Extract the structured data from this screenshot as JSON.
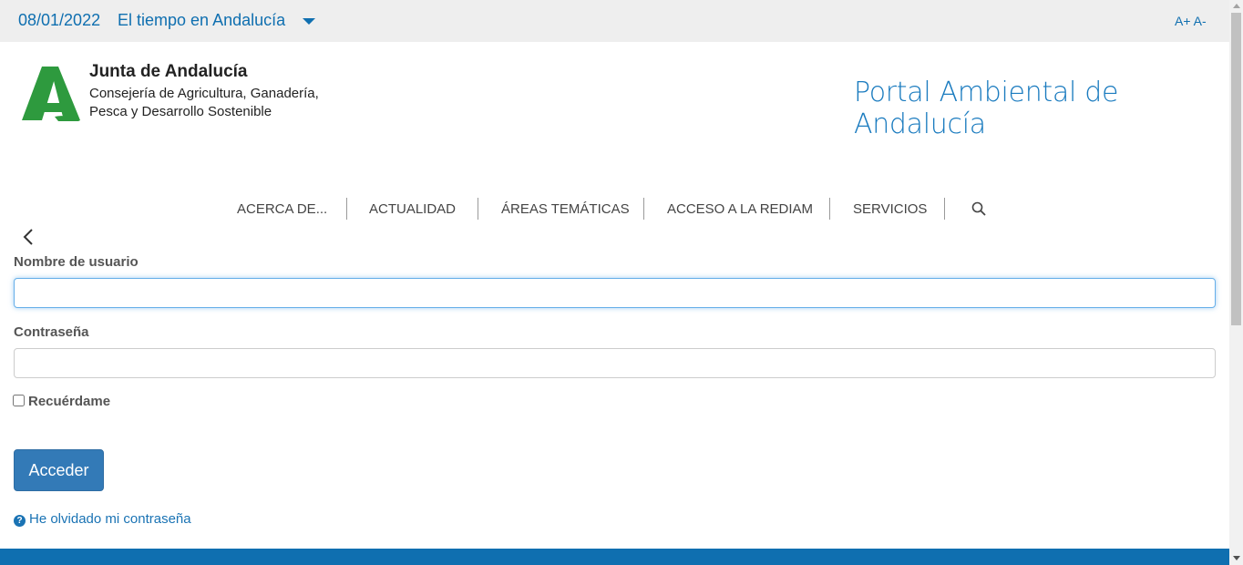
{
  "topbar": {
    "date": "08/01/2022",
    "weather_link": "El tiempo en Andalucía",
    "font_increase": "A+",
    "font_decrease": "A-"
  },
  "header": {
    "org_name": "Junta de Andalucía",
    "department_line1": "Consejería de Agricultura, Ganadería,",
    "department_line2": "Pesca y Desarrollo Sostenible",
    "portal_title": "Portal Ambiental de Andalucía"
  },
  "nav": {
    "items": [
      "ACERCA DE...",
      "ACTUALIDAD",
      "ÁREAS TEMÁTICAS",
      "ACCESO A LA REDIAM",
      "SERVICIOS"
    ],
    "search_icon": "search-icon"
  },
  "login": {
    "back_icon": "chevron-left-icon",
    "username_label": "Nombre de usuario",
    "username_value": "",
    "password_label": "Contraseña",
    "password_value": "",
    "remember_label": "Recuérdame",
    "remember_checked": false,
    "submit_label": "Acceder",
    "forgot_label": "He olvidado mi contraseña",
    "forgot_icon": "question-circle-icon"
  },
  "colors": {
    "accent": "#0f6fb0",
    "button": "#337ab7",
    "logo_green": "#2e9a3e"
  }
}
